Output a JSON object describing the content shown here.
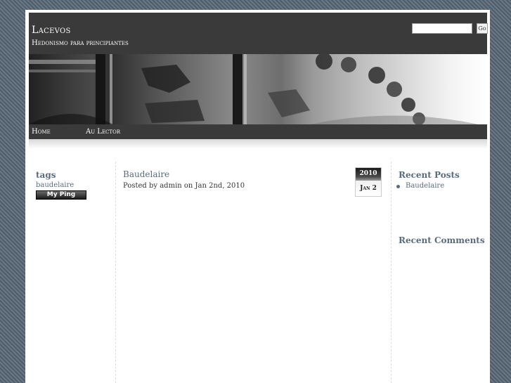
{
  "site": {
    "title": "Lacevos",
    "tagline": "Hedonismo para principiantes"
  },
  "search": {
    "value": "",
    "button_label": "Go"
  },
  "nav": {
    "items": [
      {
        "label": "Home"
      },
      {
        "label": "Au Lector"
      }
    ]
  },
  "left_sidebar": {
    "tags_heading": "tags",
    "tags": [
      "baudelaire"
    ],
    "ping_label": "My Ping"
  },
  "post": {
    "title": "Baudelaire",
    "meta": "Posted by admin on Jan 2nd, 2010",
    "date_year": "2010",
    "date_day": "Jan 2"
  },
  "right_sidebar": {
    "recent_posts_heading": "Recent Posts",
    "recent_posts": [
      "Baudelaire"
    ],
    "recent_comments_heading": "Recent Comments"
  },
  "colors": {
    "header_bg": "#3a3a3a",
    "link": "#5a6b7d",
    "background_stripe": "#5b6977"
  }
}
